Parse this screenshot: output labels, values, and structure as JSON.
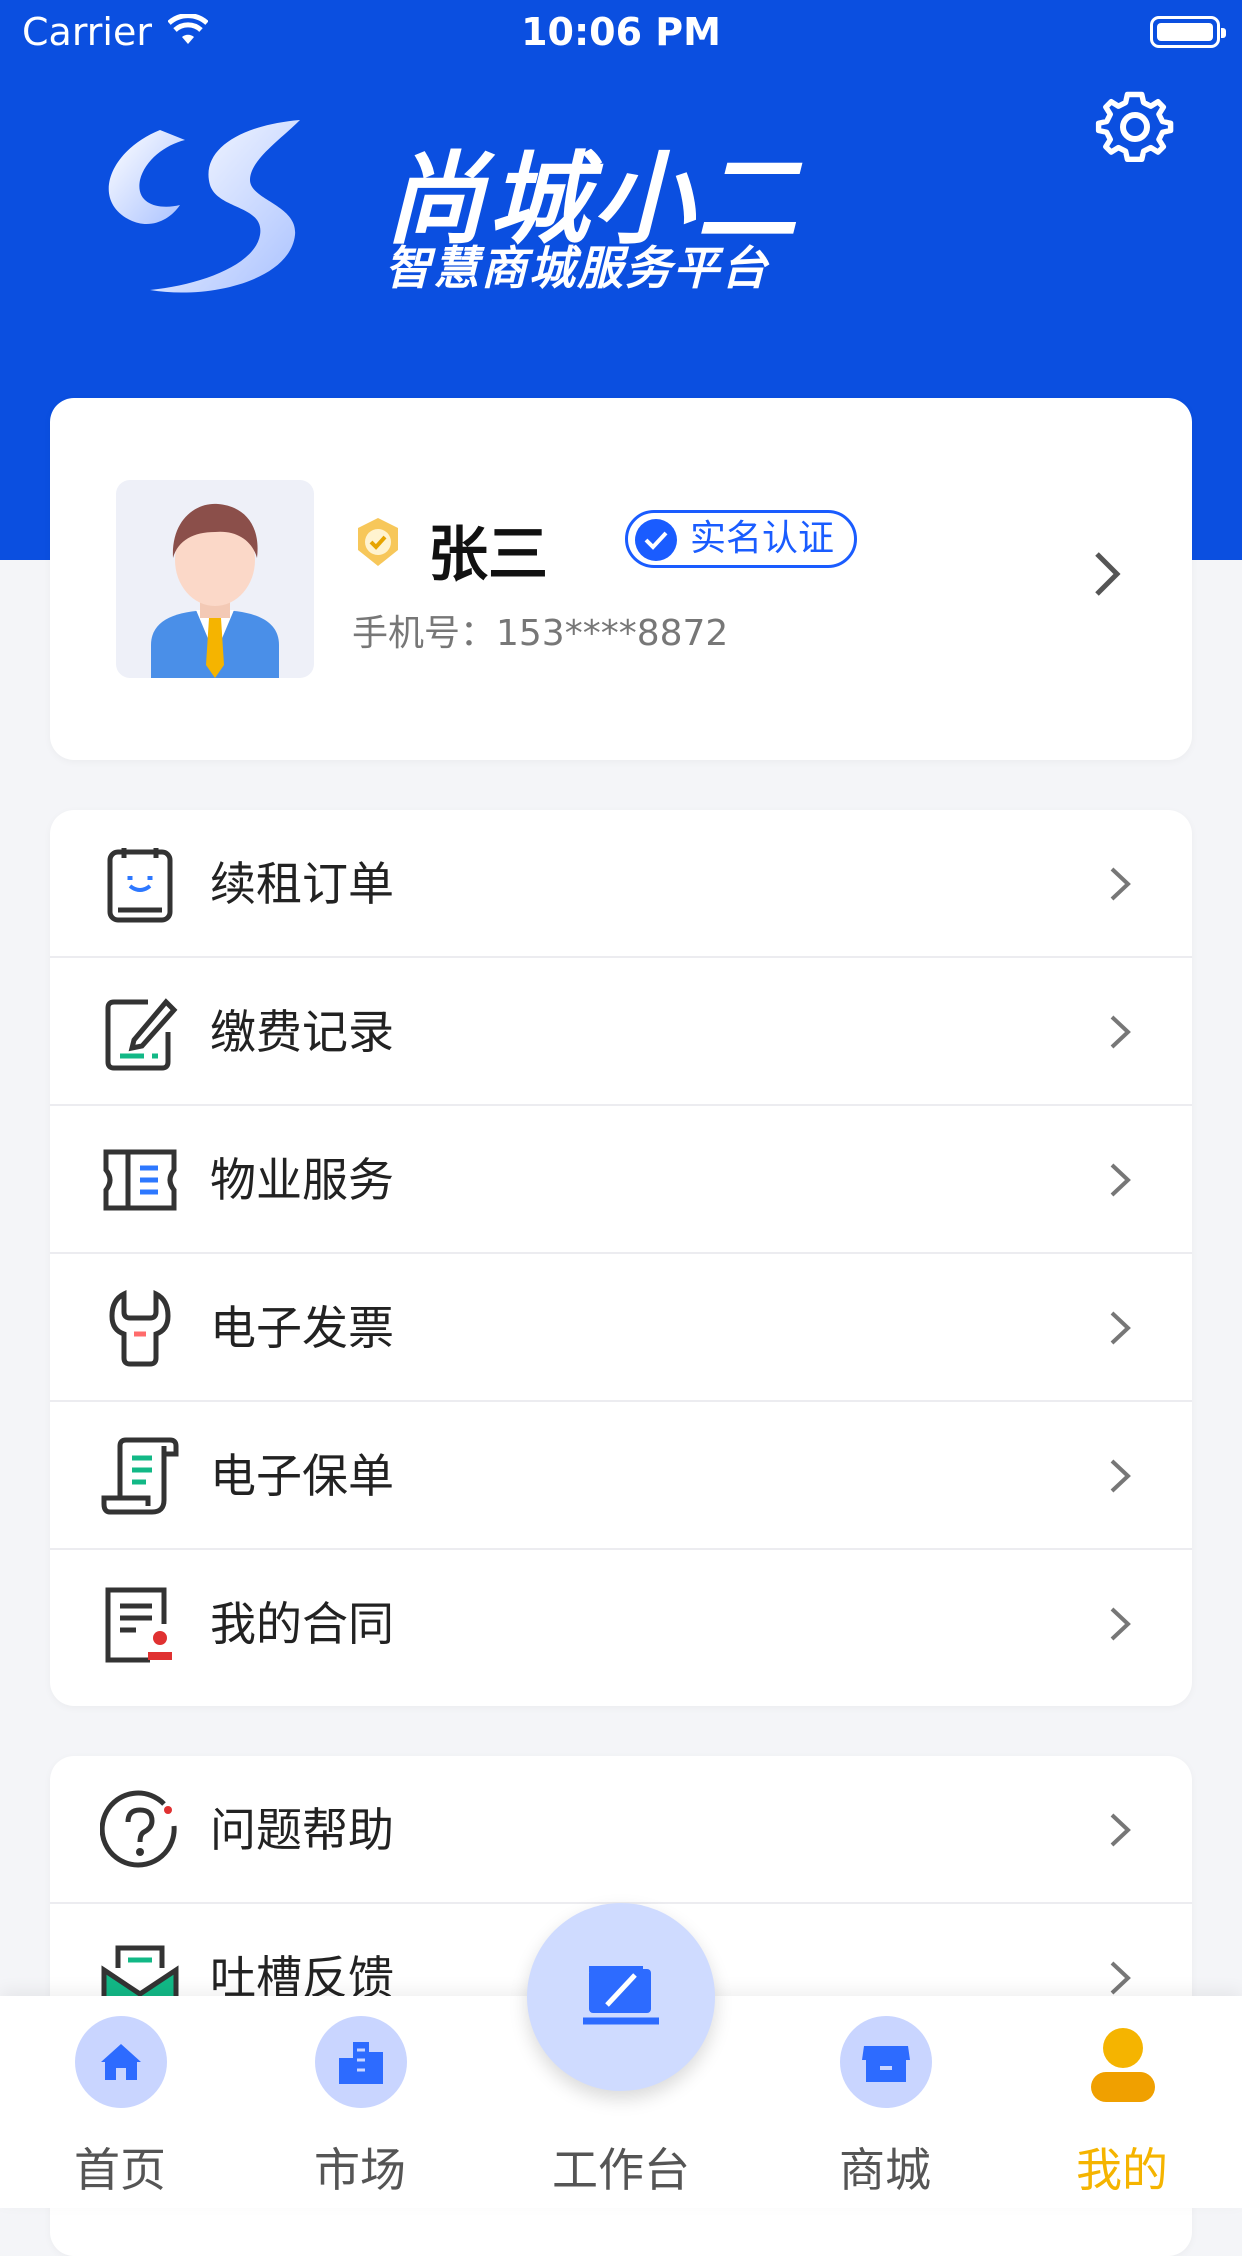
{
  "status_bar": {
    "carrier": "Carrier",
    "time": "10:06 PM"
  },
  "brand": {
    "title": "尚城小二",
    "subtitle": "智慧商城服务平台"
  },
  "profile": {
    "name": "张三",
    "verified_label": "实名认证",
    "phone": "手机号：153****8872"
  },
  "menu_group_1": [
    {
      "label": "续租订单",
      "icon": "renewal-order-icon"
    },
    {
      "label": "缴费记录",
      "icon": "payment-record-icon"
    },
    {
      "label": "物业服务",
      "icon": "property-service-icon"
    },
    {
      "label": "电子发票",
      "icon": "e-invoice-icon"
    },
    {
      "label": "电子保单",
      "icon": "e-policy-icon"
    },
    {
      "label": "我的合同",
      "icon": "contract-icon"
    }
  ],
  "menu_group_2": [
    {
      "label": "问题帮助",
      "icon": "help-icon"
    },
    {
      "label": "吐槽反馈",
      "icon": "feedback-icon"
    }
  ],
  "tabbar": {
    "home": "首页",
    "market": "市场",
    "workbench": "工作台",
    "mall": "商城",
    "mine": "我的"
  },
  "colors": {
    "brand_blue": "#0b4fe0",
    "accent": "#1a5cff",
    "active_tab": "#f5b400"
  }
}
